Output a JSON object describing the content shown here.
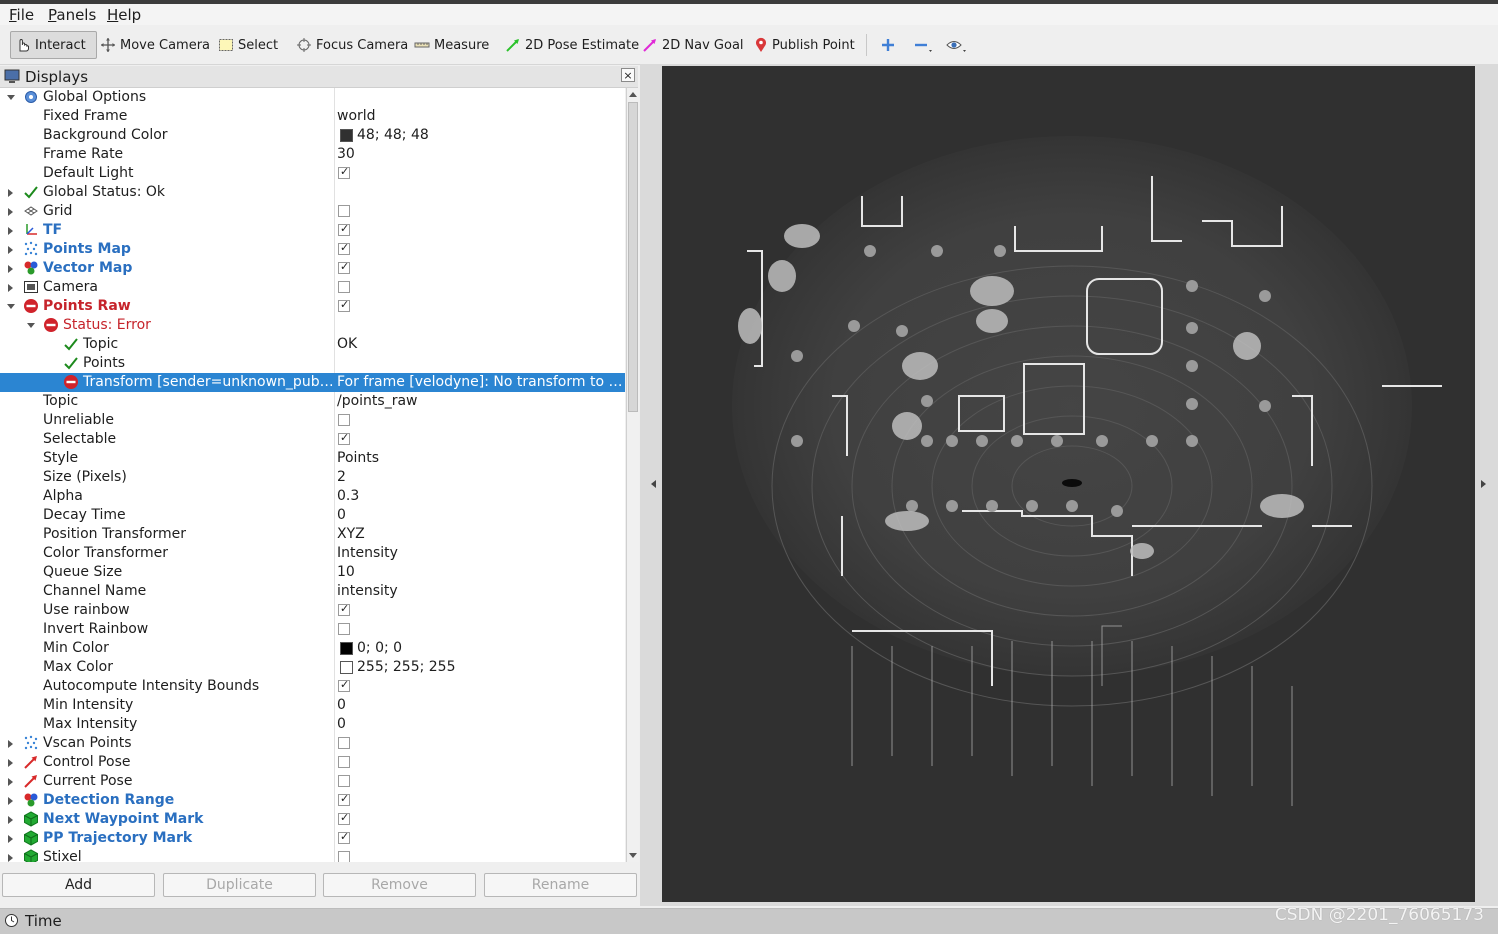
{
  "menu": [
    {
      "first": "F",
      "rest": "ile"
    },
    {
      "first": "P",
      "rest": "anels"
    },
    {
      "first": "H",
      "rest": "elp"
    }
  ],
  "toolbar": {
    "interact": "Interact",
    "move_camera": "Move Camera",
    "select": "Select",
    "focus_camera": "Focus Camera",
    "measure": "Measure",
    "pose_estimate": "2D Pose Estimate",
    "nav_goal": "2D Nav Goal",
    "publish_point": "Publish Point"
  },
  "displays_panel": {
    "title": "Displays",
    "close": "×",
    "rows": [
      {
        "label": "Global Options",
        "depth": 0,
        "exp": "open",
        "icon": "gear-icon"
      },
      {
        "label": "Fixed Frame",
        "depth": 1,
        "value": "world"
      },
      {
        "label": "Background Color",
        "depth": 1,
        "value": "48; 48; 48",
        "swatch": "#303030"
      },
      {
        "label": "Frame Rate",
        "depth": 1,
        "value": "30"
      },
      {
        "label": "Default Light",
        "depth": 1,
        "check": true
      },
      {
        "label": "Global Status: Ok",
        "depth": 0,
        "exp": "closed",
        "icon": "check-icon"
      },
      {
        "label": "Grid",
        "depth": 0,
        "exp": "closed",
        "icon": "grid-icon",
        "check": false
      },
      {
        "label": "TF",
        "depth": 0,
        "exp": "closed",
        "icon": "tf-axes-icon",
        "check": true,
        "style": "blue"
      },
      {
        "label": "Points Map",
        "depth": 0,
        "exp": "closed",
        "icon": "points-icon",
        "check": true,
        "style": "blue"
      },
      {
        "label": "Vector Map",
        "depth": 0,
        "exp": "closed",
        "icon": "marker-array-icon",
        "check": true,
        "style": "blue"
      },
      {
        "label": "Camera",
        "depth": 0,
        "exp": "closed",
        "icon": "camera-icon",
        "check": false
      },
      {
        "label": "Points Raw",
        "depth": 0,
        "exp": "open",
        "icon": "error-icon",
        "check": true,
        "style": "err"
      },
      {
        "label": "Status: Error",
        "depth": 1,
        "exp": "open",
        "icon": "error-icon",
        "style": "errn"
      },
      {
        "label": "Topic",
        "depth": 2,
        "icon": "check-icon",
        "value": "OK"
      },
      {
        "label": "Points",
        "depth": 2,
        "icon": "check-icon"
      },
      {
        "label": "Transform [sender=unknown_pub…",
        "depth": 2,
        "icon": "error-icon",
        "value": "For frame [velodyne]: No transform to …",
        "selected": true
      },
      {
        "label": "Topic",
        "depth": 1,
        "value": "/points_raw"
      },
      {
        "label": "Unreliable",
        "depth": 1,
        "check": false
      },
      {
        "label": "Selectable",
        "depth": 1,
        "check": true
      },
      {
        "label": "Style",
        "depth": 1,
        "value": "Points"
      },
      {
        "label": "Size (Pixels)",
        "depth": 1,
        "value": "2"
      },
      {
        "label": "Alpha",
        "depth": 1,
        "value": "0.3"
      },
      {
        "label": "Decay Time",
        "depth": 1,
        "value": "0"
      },
      {
        "label": "Position Transformer",
        "depth": 1,
        "value": "XYZ"
      },
      {
        "label": "Color Transformer",
        "depth": 1,
        "value": "Intensity"
      },
      {
        "label": "Queue Size",
        "depth": 1,
        "value": "10"
      },
      {
        "label": "Channel Name",
        "depth": 1,
        "value": "intensity"
      },
      {
        "label": "Use rainbow",
        "depth": 1,
        "check": true
      },
      {
        "label": "Invert Rainbow",
        "depth": 1,
        "check": false
      },
      {
        "label": "Min Color",
        "depth": 1,
        "value": "0; 0; 0",
        "swatch": "#000000"
      },
      {
        "label": "Max Color",
        "depth": 1,
        "value": "255; 255; 255",
        "swatch": "#ffffff"
      },
      {
        "label": "Autocompute Intensity Bounds",
        "depth": 1,
        "check": true
      },
      {
        "label": "Min Intensity",
        "depth": 1,
        "value": "0"
      },
      {
        "label": "Max Intensity",
        "depth": 1,
        "value": "0"
      },
      {
        "label": "Vscan Points",
        "depth": 0,
        "exp": "closed",
        "icon": "points-icon",
        "check": false
      },
      {
        "label": "Control Pose",
        "depth": 0,
        "exp": "closed",
        "icon": "pose-arrow-icon",
        "check": false
      },
      {
        "label": "Current Pose",
        "depth": 0,
        "exp": "closed",
        "icon": "pose-arrow-icon",
        "check": false
      },
      {
        "label": "Detection Range",
        "depth": 0,
        "exp": "closed",
        "icon": "marker-array-icon",
        "check": true,
        "style": "blue"
      },
      {
        "label": "Next Waypoint Mark",
        "depth": 0,
        "exp": "closed",
        "icon": "marker-icon",
        "check": true,
        "style": "blue"
      },
      {
        "label": "PP Trajectory Mark",
        "depth": 0,
        "exp": "closed",
        "icon": "marker-icon",
        "check": true,
        "style": "blue"
      },
      {
        "label": "Stixel",
        "depth": 0,
        "exp": "closed",
        "icon": "marker-icon",
        "check": false
      }
    ]
  },
  "buttons": {
    "add": "Add",
    "duplicate": "Duplicate",
    "remove": "Remove",
    "rename": "Rename"
  },
  "time_panel": {
    "title": "Time"
  },
  "watermark": "CSDN @2201_76065173"
}
